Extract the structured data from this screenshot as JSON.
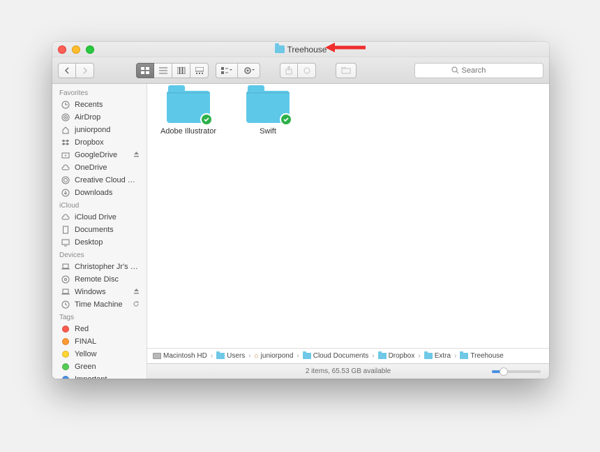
{
  "window": {
    "title": "Treehouse"
  },
  "toolbar": {
    "search_placeholder": "Search"
  },
  "sidebar": {
    "sections": [
      {
        "title": "Favorites",
        "items": [
          {
            "icon": "recents-icon",
            "label": "Recents"
          },
          {
            "icon": "airdrop-icon",
            "label": "AirDrop"
          },
          {
            "icon": "home-icon",
            "label": "juniorpond"
          },
          {
            "icon": "dropbox-icon",
            "label": "Dropbox"
          },
          {
            "icon": "drive-icon",
            "label": "GoogleDrive",
            "eject": true
          },
          {
            "icon": "cloud-icon",
            "label": "OneDrive"
          },
          {
            "icon": "cc-icon",
            "label": "Creative Cloud Files"
          },
          {
            "icon": "downloads-icon",
            "label": "Downloads"
          }
        ]
      },
      {
        "title": "iCloud",
        "items": [
          {
            "icon": "cloud-icon",
            "label": "iCloud Drive"
          },
          {
            "icon": "documents-icon",
            "label": "Documents"
          },
          {
            "icon": "desktop-icon",
            "label": "Desktop"
          }
        ]
      },
      {
        "title": "Devices",
        "items": [
          {
            "icon": "laptop-icon",
            "label": "Christopher Jr's Ret…"
          },
          {
            "icon": "disc-icon",
            "label": "Remote Disc"
          },
          {
            "icon": "laptop-icon",
            "label": "Windows",
            "eject": true
          },
          {
            "icon": "timemachine-icon",
            "label": "Time Machine",
            "refresh": true
          }
        ]
      },
      {
        "title": "Tags",
        "items": [
          {
            "tag": "#ff5a4d",
            "label": "Red"
          },
          {
            "tag": "#ff9933",
            "label": "FINAL"
          },
          {
            "tag": "#ffd633",
            "label": "Yellow"
          },
          {
            "tag": "#55cc55",
            "label": "Green"
          },
          {
            "tag": "#4a90e2",
            "label": "Important"
          }
        ]
      }
    ]
  },
  "items": [
    {
      "name": "Adobe Illustrator",
      "synced": true
    },
    {
      "name": "Swift",
      "synced": true
    }
  ],
  "path": [
    {
      "icon": "hd",
      "label": "Macintosh HD"
    },
    {
      "icon": "folder",
      "label": "Users"
    },
    {
      "icon": "home",
      "label": "juniorpond"
    },
    {
      "icon": "folder",
      "label": "Cloud Documents"
    },
    {
      "icon": "folder",
      "label": "Dropbox"
    },
    {
      "icon": "folder",
      "label": "Extra"
    },
    {
      "icon": "folder",
      "label": "Treehouse"
    }
  ],
  "status": "2 items, 65.53 GB available"
}
